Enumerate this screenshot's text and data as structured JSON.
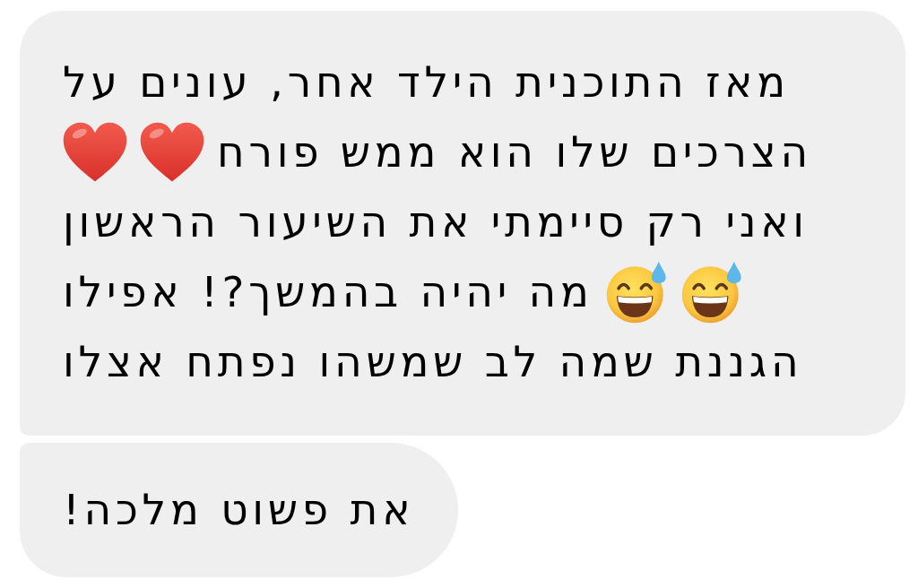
{
  "messages": [
    {
      "lines": [
        {
          "parts": [
            {
              "kind": "text",
              "text": "מאז התוכנית הילד אחר, עונים על"
            }
          ]
        },
        {
          "parts": [
            {
              "kind": "text",
              "text": "הצרכים שלו הוא ממש פורח"
            },
            {
              "kind": "heart"
            },
            {
              "kind": "heart"
            }
          ]
        },
        {
          "parts": [
            {
              "kind": "text",
              "text": "ואני רק סיימתי את השיעור הראשון"
            }
          ]
        },
        {
          "parts": [
            {
              "kind": "sweat_smile"
            },
            {
              "kind": "sweat_smile"
            },
            {
              "kind": "text",
              "text": "מה יהיה בהמשך?! אפילו"
            }
          ]
        },
        {
          "parts": [
            {
              "kind": "text",
              "text": "הגננת שמה לב שמשהו נפתח אצלו"
            }
          ]
        }
      ]
    },
    {
      "lines": [
        {
          "parts": [
            {
              "kind": "text",
              "text": "את פשוט מלכה!"
            }
          ]
        }
      ]
    }
  ]
}
